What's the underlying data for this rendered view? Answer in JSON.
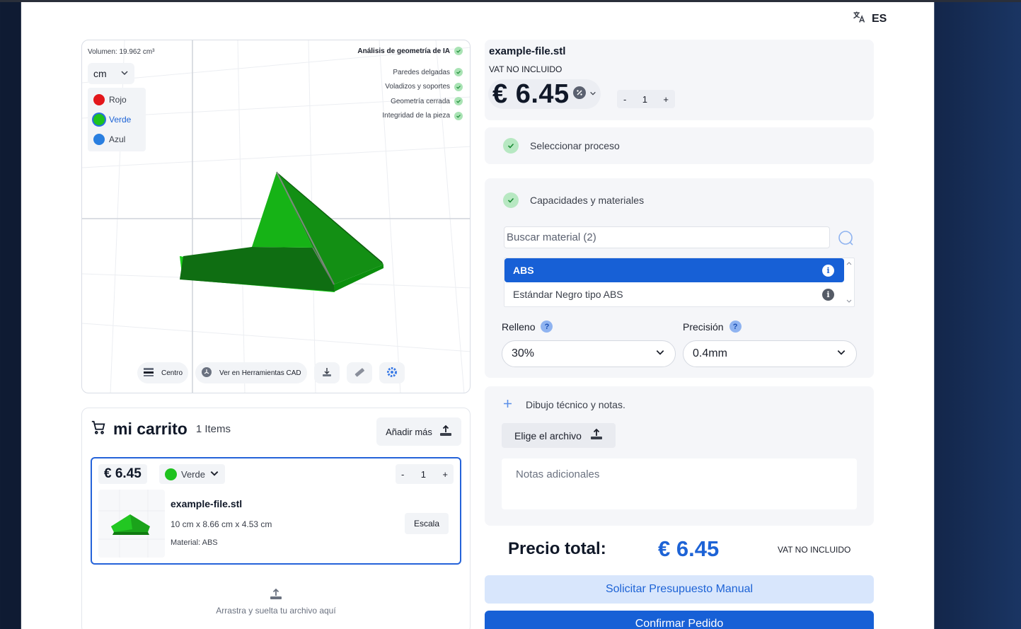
{
  "header": {
    "language_code": "ES",
    "language_icon": "translate-icon"
  },
  "viewer": {
    "volume": "Volumen: 19.962 cm³",
    "unit": "cm",
    "colors": [
      {
        "label": "Rojo",
        "hex": "#e3171b"
      },
      {
        "label": "Verde",
        "hex": "#1ec21e",
        "selected": true
      },
      {
        "label": "Azul",
        "hex": "#2a7fe0"
      }
    ],
    "ai_title": "Análisis de geometría de IA",
    "ai_checks": [
      "Paredes delgadas",
      "Voladizos y soportes",
      "Geometría cerrada",
      "Integridad de la pieza"
    ],
    "tools": {
      "center": "Centro",
      "cad": "Ver en Herramientas CAD"
    }
  },
  "cart": {
    "title": "mi carrito",
    "count": "1 Items",
    "add_more": "Añadir más",
    "item": {
      "price": "€ 6.45",
      "color": "Verde",
      "qty": "1",
      "minus": "-",
      "plus": "+",
      "name": "example-file.stl",
      "dims": "10 cm x 8.66 cm x 4.53 cm",
      "material": "Material: ABS",
      "scale": "Escala"
    },
    "drop_text": "Arrastra y suelta tu archivo aquí"
  },
  "summary": {
    "name": "example-file.stl",
    "vat": "VAT NO INCLUIDO",
    "price": "€ 6.45",
    "qty": "1",
    "minus": "-",
    "plus": "+"
  },
  "process": {
    "label": "Seleccionar proceso"
  },
  "materials": {
    "label": "Capacidades y materiales",
    "search_placeholder": "Buscar material (2)",
    "items": [
      {
        "label": "ABS",
        "selected": true
      },
      {
        "label": "Estándar Negro tipo ABS"
      }
    ],
    "infill_label": "Relleno",
    "infill_value": "30%",
    "precision_label": "Precisión",
    "precision_value": "0.4mm"
  },
  "drawing": {
    "label": "Dibujo técnico y notas.",
    "choose_file": "Elige el archivo",
    "notes_placeholder": "Notas adicionales"
  },
  "total": {
    "label": "Precio total:",
    "price": "€ 6.45",
    "vat": "VAT NO INCLUIDO"
  },
  "actions": {
    "manual_quote": "Solicitar Presupuesto Manual",
    "confirm": "Confirmar Pedido"
  },
  "theme": {
    "accent": "#1760d6",
    "model_green": "#1ec21e"
  }
}
